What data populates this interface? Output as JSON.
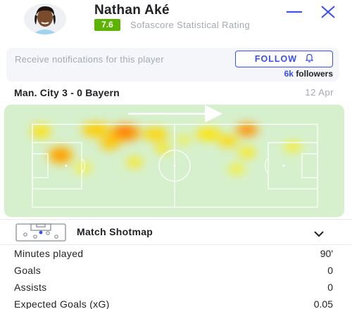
{
  "player": {
    "name": "Nathan Aké",
    "rating": "7.6",
    "rating_label": "Sofascore Statistical Rating",
    "rating_color": "#5cb400"
  },
  "window_controls": {
    "minimize_icon": "minus-icon",
    "close_icon": "x-icon"
  },
  "notifications": {
    "text": "Receive notifications for this player",
    "follow_label": "FOLLOW",
    "follow_icon": "bell-icon",
    "followers_count": "6k",
    "followers_label": "followers",
    "accent_color": "#374df5"
  },
  "match": {
    "title": "Man. City 3 - 0 Bayern",
    "date": "12 Apr"
  },
  "heatmap": {
    "attack_direction": "right",
    "pitch_color": "#d6f0cd"
  },
  "shotmap": {
    "label": "Match Shotmap",
    "icon": "shotmap-icon",
    "chevron_icon": "chevron-down-icon"
  },
  "stats": [
    {
      "label": "Minutes played",
      "value": "90'"
    },
    {
      "label": "Goals",
      "value": "0"
    },
    {
      "label": "Assists",
      "value": "0"
    },
    {
      "label": "Expected Goals (xG)",
      "value": "0.05"
    }
  ]
}
